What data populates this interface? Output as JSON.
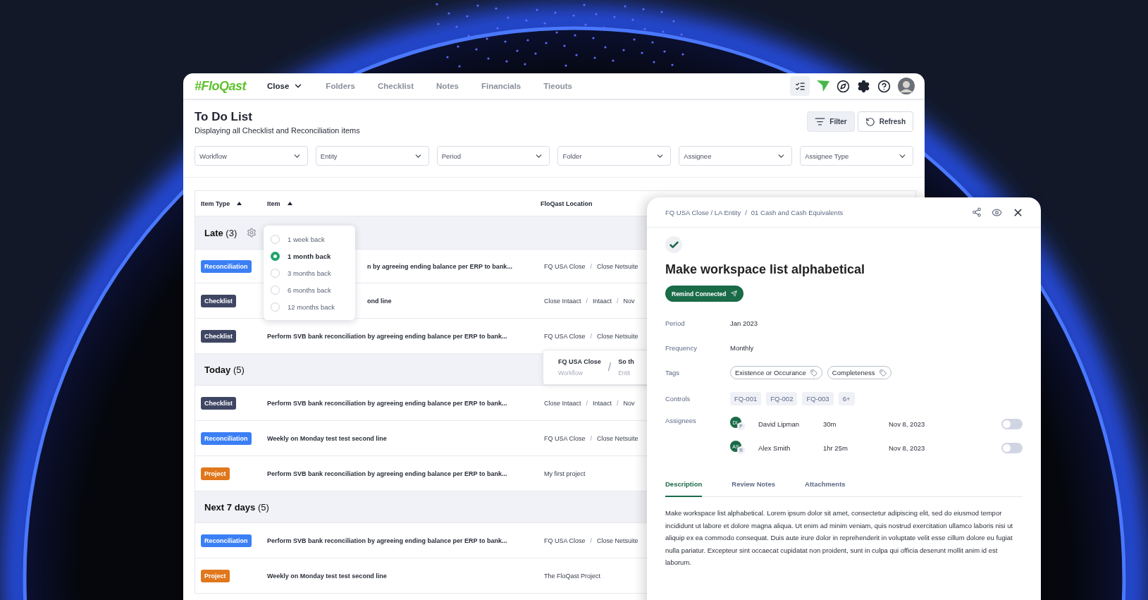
{
  "nav": {
    "logo": "#FloQast",
    "items": [
      {
        "label": "Close",
        "selected": true,
        "has_menu": true
      },
      {
        "label": "Folders",
        "selected": false,
        "has_menu": false
      },
      {
        "label": "Checklist",
        "selected": false,
        "has_menu": false
      },
      {
        "label": "Notes",
        "selected": false,
        "has_menu": false
      },
      {
        "label": "Financials",
        "selected": false,
        "has_menu": false
      },
      {
        "label": "Tieouts",
        "selected": false,
        "has_menu": false
      }
    ]
  },
  "page": {
    "title": "To Do List",
    "subtitle": "Displaying all Checklist and Reconciliation items",
    "buttons": [
      {
        "label": "Filter",
        "kind": "filter"
      },
      {
        "label": "Refresh",
        "kind": "refresh"
      }
    ]
  },
  "filters": [
    "Workflow",
    "Entity",
    "Period",
    "Folder",
    "Assignee",
    "Assignee Type"
  ],
  "table": {
    "separator": "/",
    "columns": [
      {
        "label": "Item Type",
        "sorted": true
      },
      {
        "label": "Item",
        "sorted": true
      },
      {
        "label": "FloQast Location",
        "sorted": false
      }
    ],
    "groups": [
      {
        "title": "Late",
        "count": "(3)",
        "has_settings": true,
        "rows": [
          {
            "kind": "reconciliation",
            "type": "Reconciliation",
            "item": "n by agreeing ending balance per ERP to bank...",
            "covered": true,
            "location": [
              "FQ USA Close",
              "Close Netsuite"
            ]
          },
          {
            "kind": "checklist",
            "type": "Checklist",
            "item": "ond line",
            "covered": true,
            "location": [
              "Close Intaact",
              "Intaact",
              "Nov"
            ]
          },
          {
            "kind": "checklist",
            "type": "Checklist",
            "item": "Perform SVB bank reconciliation by agreeing ending balance per ERP to bank...",
            "covered": false,
            "location": [
              "FQ USA Close",
              "Close Netsuite"
            ]
          }
        ]
      },
      {
        "title": "Today",
        "count": "(5)",
        "has_settings": false,
        "rows": [
          {
            "kind": "checklist",
            "type": "Checklist",
            "item": "Perform SVB bank reconciliation by agreeing ending balance per ERP to bank...",
            "covered": false,
            "location": [
              "Close Intaact",
              "Intaact",
              "Nov"
            ]
          },
          {
            "kind": "reconciliation",
            "type": "Reconciliation",
            "item": "Weekly on Monday test test second line",
            "covered": false,
            "location": [
              "FQ USA Close",
              "Close Netsuite"
            ]
          },
          {
            "kind": "project",
            "type": "Project",
            "item": "Perform SVB bank reconciliation by agreeing ending balance per ERP to bank...",
            "covered": false,
            "location": [
              "My first project"
            ]
          }
        ]
      },
      {
        "title": "Next 7 days",
        "count": "(5)",
        "has_settings": false,
        "rows": [
          {
            "kind": "reconciliation",
            "type": "Reconciliation",
            "item": "Perform SVB bank reconciliation by agreeing ending balance per ERP to bank...",
            "covered": false,
            "location": [
              "FQ USA Close",
              "Close Netsuite"
            ]
          },
          {
            "kind": "project",
            "type": "Project",
            "item": "Weekly on Monday test test second line",
            "covered": false,
            "location": [
              "The FloQast Project"
            ]
          }
        ]
      }
    ]
  },
  "period_menu": {
    "options": [
      {
        "label": "1 week back",
        "selected": false
      },
      {
        "label": "1 month back",
        "selected": true
      },
      {
        "label": "3 months back",
        "selected": false
      },
      {
        "label": "6 months back",
        "selected": false
      },
      {
        "label": "12 months back",
        "selected": false
      }
    ]
  },
  "location_tooltip": {
    "separator": "/",
    "columns": [
      {
        "value": "FQ USA Close",
        "label": "Workflow"
      },
      {
        "value": "So th",
        "label": "Entit"
      }
    ]
  },
  "detail": {
    "breadcrumb_separator": "/",
    "breadcrumb": [
      "FQ USA Close / LA Entity",
      "01 Cash and Cash Equivalents"
    ],
    "done": true,
    "title": "Make workspace list alphabetical",
    "action": "Remind Connected",
    "fields": [
      {
        "label": "Period",
        "value": "Jan 2023"
      },
      {
        "label": "Frequency",
        "value": "Monthly"
      }
    ],
    "tags_label": "Tags",
    "tags": [
      "Existence or Occurance",
      "Completeness"
    ],
    "controls_label": "Controls",
    "controls": [
      "FQ-001",
      "FQ-002",
      "FQ-003",
      "6+"
    ],
    "assignees_label": "Assignees",
    "assignees": [
      {
        "initials": "DL",
        "role": "P",
        "name": "David Lipman",
        "time": "30m",
        "date": "Nov 8, 2023",
        "on": false
      },
      {
        "initials": "AS",
        "role": "R",
        "name": "Alex Smith",
        "time": "1hr 25m",
        "date": "Nov 8, 2023",
        "on": false
      }
    ],
    "tabs": [
      {
        "label": "Description",
        "selected": true
      },
      {
        "label": "Review Notes",
        "selected": false
      },
      {
        "label": "Attachments",
        "selected": false
      }
    ],
    "description": "Make workspace list alphabetical. Lorem ipsum dolor sit amet, consectetur adipiscing elit, sed do eiusmod tempor incididunt ut labore et dolore magna aliqua. Ut enim ad minim veniam, quis nostrud exercitation ullamco laboris nisi ut aliquip ex ea commodo consequat. Duis aute irure dolor in reprehenderit in voluptate velit esse cillum dolore eu fugiat nulla pariatur. Excepteur sint occaecat cupidatat non proident, sunt in culpa qui officia deserunt mollit anim id est laborum."
  }
}
